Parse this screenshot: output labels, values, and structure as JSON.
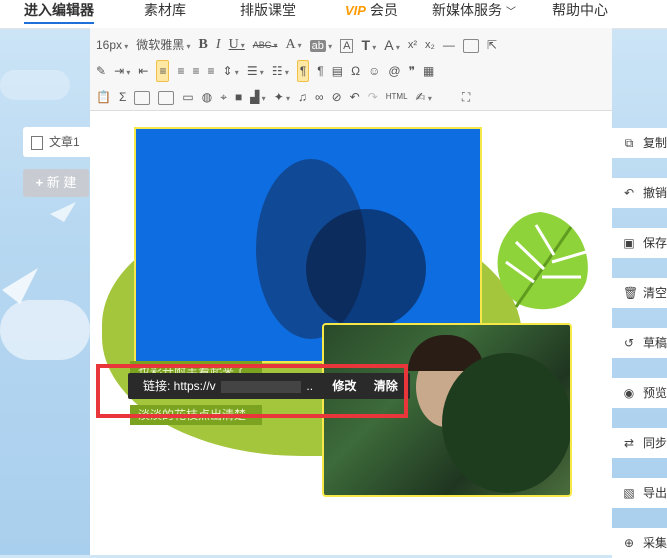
{
  "nav": {
    "items": [
      {
        "label": "进入编辑器",
        "active": true
      },
      {
        "label": "素材库"
      },
      {
        "label": "排版课堂"
      },
      {
        "label": "会员",
        "badge": "VIP"
      },
      {
        "label": "新媒体服务",
        "dropdown": true
      },
      {
        "label": "帮助中心"
      }
    ]
  },
  "sidebar": {
    "doc_tab": "文章1",
    "new_button": "新 建"
  },
  "toolbar": {
    "font_size": "16px",
    "font_family": "微软雅黑",
    "bold": "B",
    "italic": "I",
    "underline": "U",
    "strikethrough": "ABC",
    "font_color": "A",
    "highlight": "ab",
    "border_text": "A",
    "text_shadow": "T",
    "font_grow": "A",
    "superscript": "x²",
    "subscript": "x₂",
    "html_label": "HTML"
  },
  "content": {
    "caption1": "也彩开附丰着起来了",
    "caption2": "淡淡的花枝点出清楚",
    "link_popup": {
      "label": "链接: https://v",
      "ellipsis": "..",
      "edit": "修改",
      "clear": "清除"
    }
  },
  "right_panel": {
    "items": [
      {
        "label": "复制",
        "icon": "copy-icon"
      },
      {
        "label": "撤销",
        "icon": "undo-icon"
      },
      {
        "label": "保存",
        "icon": "save-icon"
      },
      {
        "label": "清空",
        "icon": "trash-icon"
      },
      {
        "label": "草稿",
        "icon": "history-icon"
      },
      {
        "label": "预览",
        "icon": "eye-icon"
      },
      {
        "label": "同步",
        "icon": "sync-icon"
      },
      {
        "label": "导出",
        "icon": "export-icon"
      },
      {
        "label": "采集",
        "icon": "search-icon"
      }
    ]
  },
  "colors": {
    "accent": "#1e6fd9",
    "vip": "#ff9a00",
    "highlight_box": "#e8363a",
    "image_border": "#f7e84a",
    "green": "#a4c63c"
  }
}
